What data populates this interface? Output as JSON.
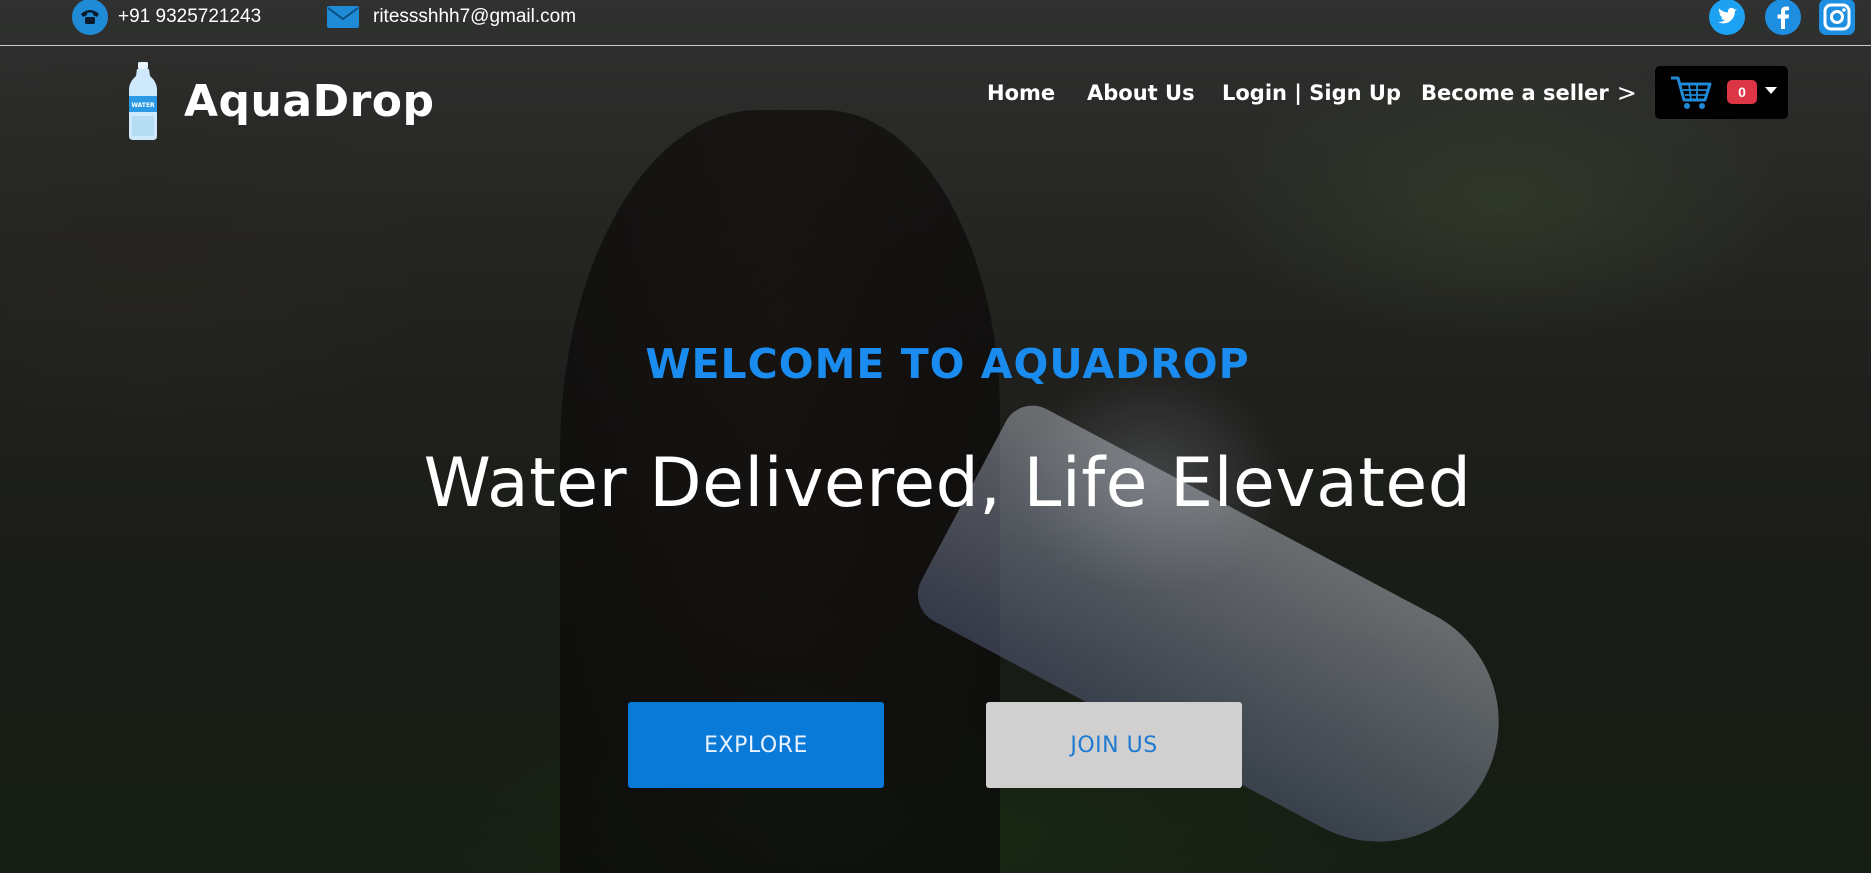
{
  "contact": {
    "phone_icon": "phone-icon",
    "phone": "+91 9325721243",
    "email_icon": "mail-icon",
    "email": "ritessshhh7@gmail.com"
  },
  "social": [
    {
      "name": "twitter-icon",
      "color": "#1da1f2"
    },
    {
      "name": "facebook-icon",
      "color": "#1e8fe0"
    },
    {
      "name": "instagram-icon",
      "color": "#1e8fe0"
    }
  ],
  "brand": {
    "name": "AquaDrop",
    "logo_icon": "water-bottle-icon",
    "logo_text": "WATER"
  },
  "nav": {
    "home": "Home",
    "about": "About Us",
    "login": "Login | Sign Up",
    "seller": "Become a seller",
    "seller_chevron": ">"
  },
  "cart": {
    "icon": "cart-icon",
    "count": "0"
  },
  "hero": {
    "welcome": "WELCOME TO AQUADROP",
    "tagline": "Water Delivered, Life Elevated",
    "explore_label": "EXPLORE",
    "join_label": "JOIN US"
  },
  "colors": {
    "accent": "#1a8cf0",
    "primary_button": "#0a7ad9",
    "secondary_button": "#d0d0d0",
    "badge": "#dc3545"
  }
}
